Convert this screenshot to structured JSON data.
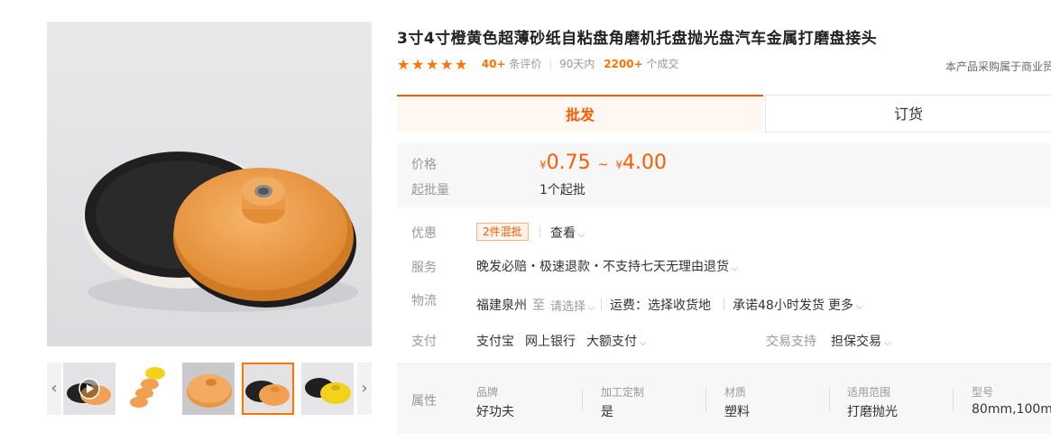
{
  "product": {
    "title": "3寸4寸橙黄色超薄砂纸自粘盘角磨机托盘抛光盘汽车金属打磨盘接头"
  },
  "stats": {
    "review_count": "40+",
    "review_label": "条评价",
    "period_label": "90天内",
    "sold_count": "2200+",
    "sold_label": "个成交",
    "rating_stars": 5
  },
  "note": "本产品采购属于商业贸",
  "tabs": [
    {
      "label": "批发",
      "active": true
    },
    {
      "label": "订货",
      "active": false
    }
  ],
  "price": {
    "label": "价格",
    "currency": "¥",
    "min": "0.75",
    "tilde": "~",
    "max": "4.00",
    "min_qty_label": "起批量",
    "min_qty": "1个起批"
  },
  "promo": {
    "label": "优惠",
    "badge": "2件混批",
    "view_label": "查看"
  },
  "service": {
    "label": "服务",
    "text": "晚发必赔・极速退款・不支持七天无理由退货"
  },
  "logistics": {
    "label": "物流",
    "origin": "福建泉州",
    "to": "至",
    "select": "请选择",
    "fee": "运费：选择收货地",
    "promise": "承诺48小时发货",
    "more": "更多"
  },
  "payment": {
    "label": "支付",
    "methods": [
      "支付宝",
      "网上银行",
      "大额支付"
    ],
    "trade_support_label": "交易支持",
    "trade_support": "担保交易"
  },
  "attributes": {
    "label": "属性",
    "items": [
      {
        "key": "品牌",
        "value": "好功夫"
      },
      {
        "key": "加工定制",
        "value": "是"
      },
      {
        "key": "材质",
        "value": "塑料"
      },
      {
        "key": "适用范围",
        "value": "打磨抛光"
      },
      {
        "key": "型号",
        "value": "80mm,100m..."
      }
    ]
  },
  "colors": {
    "accent": "#ff5a00",
    "orange_disc": "#f0a050",
    "black_pad": "#1e1e1e"
  }
}
